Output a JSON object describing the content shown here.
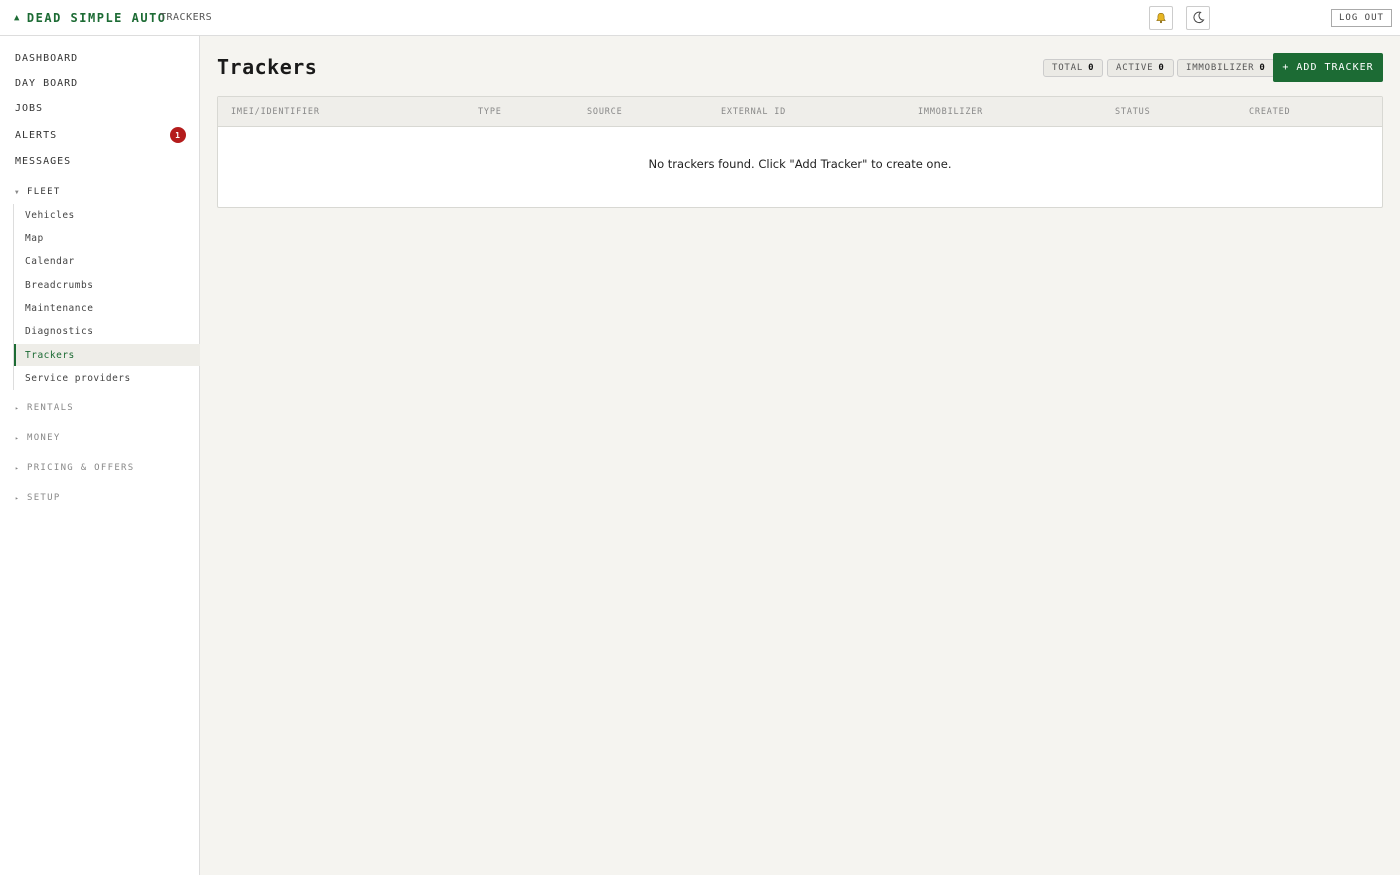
{
  "header": {
    "brand": "DEAD SIMPLE AUTO",
    "brand_icon": "car-icon",
    "breadcrumb": "TRACKERS",
    "notifications_icon": "bell-icon",
    "theme_icon": "moon-icon",
    "logout_label": "LOG OUT"
  },
  "sidebar": {
    "top_items": [
      {
        "label": "DASHBOARD"
      },
      {
        "label": "DAY BOARD"
      },
      {
        "label": "JOBS"
      },
      {
        "label": "ALERTS",
        "badge": "1"
      },
      {
        "label": "MESSAGES"
      }
    ],
    "fleet": {
      "label": "FLEET",
      "expanded": true,
      "items": [
        {
          "label": "Vehicles"
        },
        {
          "label": "Map"
        },
        {
          "label": "Calendar"
        },
        {
          "label": "Breadcrumbs"
        },
        {
          "label": "Maintenance"
        },
        {
          "label": "Diagnostics"
        },
        {
          "label": "Trackers",
          "active": true
        },
        {
          "label": "Service providers"
        }
      ]
    },
    "collapsed_groups": [
      {
        "label": "RENTALS"
      },
      {
        "label": "MONEY"
      },
      {
        "label": "PRICING & OFFERS"
      },
      {
        "label": "SETUP"
      }
    ]
  },
  "main": {
    "title": "Trackers",
    "stats": {
      "total_label": "TOTAL",
      "total_value": "0",
      "active_label": "ACTIVE",
      "active_value": "0",
      "immobilizer_label": "IMMOBILIZER",
      "immobilizer_value": "0"
    },
    "add_button_label": "+ ADD TRACKER",
    "table": {
      "columns": [
        "IMEI/IDENTIFIER",
        "TYPE",
        "SOURCE",
        "EXTERNAL ID",
        "IMMOBILIZER",
        "STATUS",
        "CREATED"
      ],
      "rows": [],
      "empty_message": "No trackers found. Click \"Add Tracker\" to create one."
    }
  },
  "colors": {
    "accent": "#1c6b34",
    "badge": "#b41c1c",
    "background": "#f5f4f0"
  }
}
